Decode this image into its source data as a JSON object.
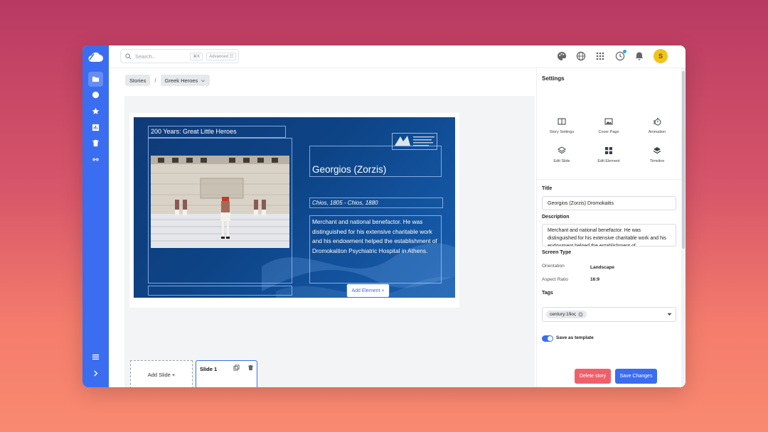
{
  "search": {
    "placeholder": "Search...",
    "shortcut": "⌘K",
    "advanced": "Advanced ☷"
  },
  "user": {
    "avatar_initial": "S"
  },
  "breadcrumb": {
    "root": "Stories",
    "separator": "/",
    "current": "Greek Heroes"
  },
  "slide": {
    "header": "200 Years: Great Little Heroes",
    "name": "Georgios (Zorzis)",
    "dates": "Chios, 1805 - Chios, 1880",
    "bio": "Merchant and national benefactor. He was distinguished for his extensive charitable work and his endowment helped the establishment of Dromokaition Psychiatric Hospital in Athens."
  },
  "editor": {
    "add_element": "Add Element +",
    "add_slide": "Add Slide +",
    "slide_thumb_label": "Slide 1"
  },
  "settings": {
    "title": "Settings",
    "tiles": [
      "Story Settings",
      "Cover Page",
      "Animation",
      "Edit Slide",
      "Edit Element",
      "Timeline"
    ],
    "title_label": "Title",
    "title_value": "Georgios (Zorzis) Dromokaitis",
    "description_label": "Description",
    "description_value": "Merchant and national benefactor. He was distinguished for his extensive charitable work and his endowment helped the establishment of",
    "screen_type_label": "Screen Type",
    "orientation_label": "Orientation",
    "orientation_value": "Landscape",
    "aspect_label": "Aspect Ratio",
    "aspect_value": "16:9",
    "tags_label": "Tags",
    "tag": "century:19oς",
    "save_template_label": "Save as template",
    "save_template_on": true,
    "delete_label": "Delete story",
    "save_label": "Save Changes"
  },
  "colors": {
    "accent": "#3b6df0",
    "danger": "#f0606a",
    "slide_bg": "#0f3a78",
    "avatar": "#f2c318"
  }
}
